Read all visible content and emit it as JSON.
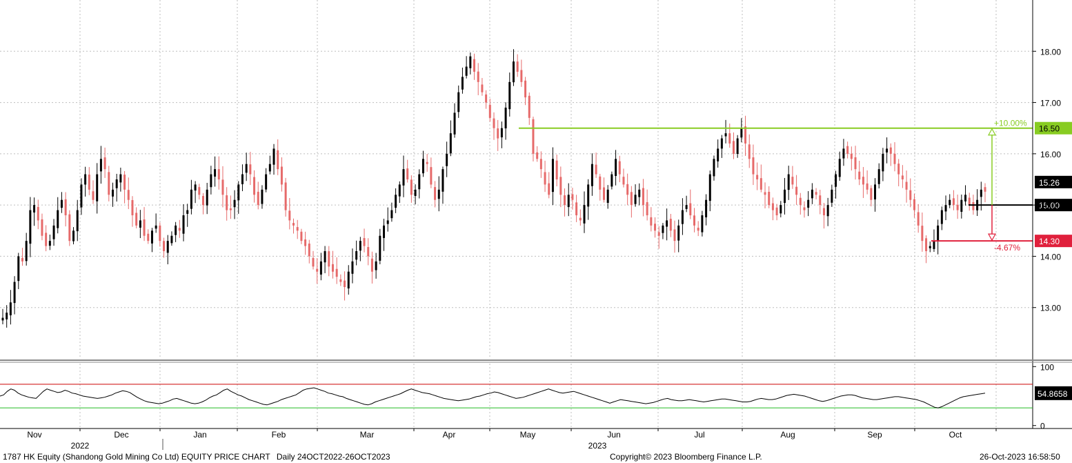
{
  "chart_data": [
    {
      "type": "candlestick",
      "panel": "price",
      "title": "1787 HK Equity (Shandong Gold Mining Co Ltd) EQUITY PRICE CHART",
      "range_label": "Daily 24OCT2022-26OCT2023",
      "ylim": [
        12.0,
        19.0
      ],
      "y_ticks": [
        "13.00",
        "14.00",
        "15.00",
        "16.00",
        "17.00",
        "18.00"
      ],
      "x_month_labels": [
        "Nov",
        "Dec",
        "Jan",
        "Feb",
        "Mar",
        "Apr",
        "May",
        "Jun",
        "Jul",
        "Aug",
        "Sep",
        "Oct"
      ],
      "x_year_labels": [
        "2022",
        "2023"
      ],
      "grid": true,
      "candles_close": [
        12.8,
        12.9,
        13.1,
        13.5,
        14.0,
        13.9,
        14.3,
        14.9,
        15.0,
        14.7,
        14.4,
        14.2,
        14.3,
        14.6,
        14.9,
        15.1,
        14.8,
        14.3,
        14.5,
        14.9,
        15.4,
        15.6,
        15.3,
        15.1,
        15.6,
        15.9,
        15.7,
        15.2,
        15.3,
        15.5,
        15.6,
        15.3,
        15.1,
        14.8,
        14.6,
        14.7,
        14.4,
        14.3,
        14.5,
        14.6,
        14.3,
        14.1,
        14.3,
        14.4,
        14.6,
        14.5,
        14.8,
        14.9,
        15.3,
        15.4,
        15.2,
        15.0,
        15.3,
        15.6,
        15.7,
        15.5,
        15.2,
        14.9,
        14.9,
        15.1,
        15.4,
        15.6,
        15.8,
        15.6,
        15.2,
        15.0,
        15.3,
        15.6,
        15.8,
        16.1,
        15.7,
        15.4,
        14.9,
        14.7,
        14.6,
        14.5,
        14.3,
        14.2,
        14.0,
        13.8,
        13.7,
        13.9,
        14.1,
        13.8,
        13.7,
        13.6,
        13.5,
        13.4,
        13.7,
        13.9,
        14.1,
        14.3,
        14.2,
        14.0,
        13.7,
        13.9,
        14.4,
        14.6,
        14.7,
        14.9,
        15.2,
        15.4,
        15.7,
        15.5,
        15.2,
        15.3,
        15.6,
        15.9,
        15.8,
        15.4,
        15.1,
        15.3,
        15.7,
        16.0,
        16.4,
        16.8,
        17.2,
        17.5,
        17.7,
        17.9,
        17.6,
        17.4,
        17.2,
        17.0,
        16.7,
        16.5,
        16.3,
        16.5,
        16.9,
        17.4,
        17.8,
        17.6,
        17.4,
        17.1,
        16.7,
        16.0,
        15.9,
        15.7,
        15.4,
        15.2,
        15.9,
        15.5,
        15.2,
        15.0,
        15.2,
        15.1,
        14.8,
        14.7,
        15.0,
        15.4,
        15.8,
        15.6,
        15.3,
        15.1,
        15.3,
        15.6,
        15.9,
        15.6,
        15.4,
        15.2,
        15.0,
        15.2,
        15.3,
        15.0,
        14.8,
        14.6,
        14.5,
        14.4,
        14.6,
        14.7,
        14.5,
        14.3,
        14.6,
        14.9,
        15.0,
        14.8,
        14.6,
        14.5,
        14.8,
        15.1,
        15.6,
        15.9,
        16.1,
        16.3,
        16.4,
        16.2,
        16.0,
        16.3,
        16.5,
        16.2,
        15.9,
        15.6,
        15.5,
        15.3,
        15.2,
        15.0,
        14.9,
        14.8,
        15.0,
        15.3,
        15.6,
        15.4,
        15.2,
        15.0,
        14.9,
        15.1,
        15.3,
        15.2,
        15.0,
        14.8,
        15.0,
        15.3,
        15.6,
        15.9,
        16.1,
        16.0,
        15.9,
        15.7,
        15.5,
        15.4,
        15.3,
        15.1,
        15.4,
        15.7,
        16.0,
        16.1,
        16.0,
        15.8,
        15.6,
        15.5,
        15.3,
        15.1,
        14.9,
        14.6,
        14.3,
        14.1,
        14.2,
        14.3,
        14.6,
        14.9,
        15.0,
        15.1,
        15.0,
        14.9,
        15.1,
        15.2,
        15.0,
        14.9,
        15.1,
        15.3,
        15.26
      ],
      "series": [
        {
          "name": "Last Price",
          "last": "15.26"
        }
      ],
      "annotations": [
        {
          "level": "16.50",
          "label": "+10.00%",
          "color": "#88cc22"
        },
        {
          "level": "15.00",
          "color": "#000000"
        },
        {
          "level": "14.30",
          "label": "-4.67%",
          "color": "#e0203c"
        }
      ]
    },
    {
      "type": "line",
      "panel": "rsi",
      "ylim": [
        -5,
        105
      ],
      "y_ticks": [
        "0",
        "100"
      ],
      "last": "54.8658",
      "upper_band": 70,
      "lower_band": 30,
      "values": [
        50,
        52,
        58,
        62,
        60,
        55,
        52,
        50,
        48,
        47,
        46,
        52,
        58,
        62,
        60,
        58,
        56,
        57,
        60,
        58,
        55,
        54,
        52,
        50,
        49,
        48,
        47,
        46,
        47,
        48,
        50,
        52,
        55,
        57,
        59,
        58,
        56,
        52,
        48,
        45,
        42,
        40,
        39,
        38,
        37,
        38,
        40,
        42,
        45,
        46,
        44,
        42,
        40,
        38,
        37,
        38,
        40,
        43,
        47,
        50,
        52,
        56,
        60,
        62,
        58,
        55,
        52,
        50,
        47,
        44,
        42,
        40,
        38,
        36,
        35,
        37,
        39,
        41,
        44,
        46,
        48,
        50,
        52,
        56,
        60,
        62,
        63,
        64,
        62,
        60,
        58,
        55,
        54,
        52,
        50,
        49,
        46,
        44,
        42,
        40,
        38,
        36,
        35,
        37,
        40,
        42,
        44,
        46,
        48,
        50,
        52,
        54,
        57,
        60,
        62,
        60,
        58,
        56,
        55,
        54,
        52,
        50,
        48,
        46,
        45,
        44,
        43,
        42,
        43,
        44,
        45,
        47,
        49,
        50,
        52,
        54,
        55,
        57,
        56,
        54,
        52,
        50,
        48,
        46,
        47,
        48,
        50,
        52,
        54,
        56,
        58,
        60,
        62,
        60,
        58,
        56,
        55,
        56,
        57,
        58,
        56,
        54,
        52,
        50,
        48,
        46,
        44,
        42,
        40,
        38,
        40,
        42,
        44,
        43,
        42,
        41,
        40,
        39,
        38,
        37,
        38,
        39,
        41,
        43,
        45,
        46,
        44,
        43,
        42,
        42,
        43,
        44,
        43,
        42,
        41,
        40,
        41,
        42,
        43,
        44,
        45,
        45,
        44,
        43,
        42,
        41,
        40,
        40,
        41,
        43,
        45,
        46,
        45,
        44,
        44,
        45,
        47,
        49,
        51,
        52,
        53,
        52,
        51,
        50,
        48,
        46,
        44,
        42,
        41,
        42,
        44,
        46,
        48,
        50,
        51,
        52,
        52,
        51,
        49,
        47,
        46,
        45,
        44,
        44,
        45,
        46,
        47,
        48,
        49,
        49,
        48,
        47,
        46,
        45,
        44,
        42,
        40,
        37,
        34,
        31,
        30,
        32,
        35,
        38,
        41,
        44,
        47,
        49,
        50,
        51,
        52,
        53,
        54,
        54.8658
      ]
    }
  ],
  "footer": {
    "left": "1787 HK Equity (Shandong Gold Mining Co Ltd) EQUITY PRICE CHART",
    "range": "Daily 24OCT2022-26OCT2023",
    "center": "Copyright© 2023 Bloomberg Finance L.P.",
    "right": "26-Oct-2023 16:58:50"
  },
  "colors": {
    "up": "#000000",
    "down": "#e66a6a",
    "grid": "#bdbdbd",
    "target_up": "#88cc22",
    "target_down": "#e0203c",
    "rsi_upper": "#cc0000",
    "rsi_lower": "#22bb22"
  }
}
